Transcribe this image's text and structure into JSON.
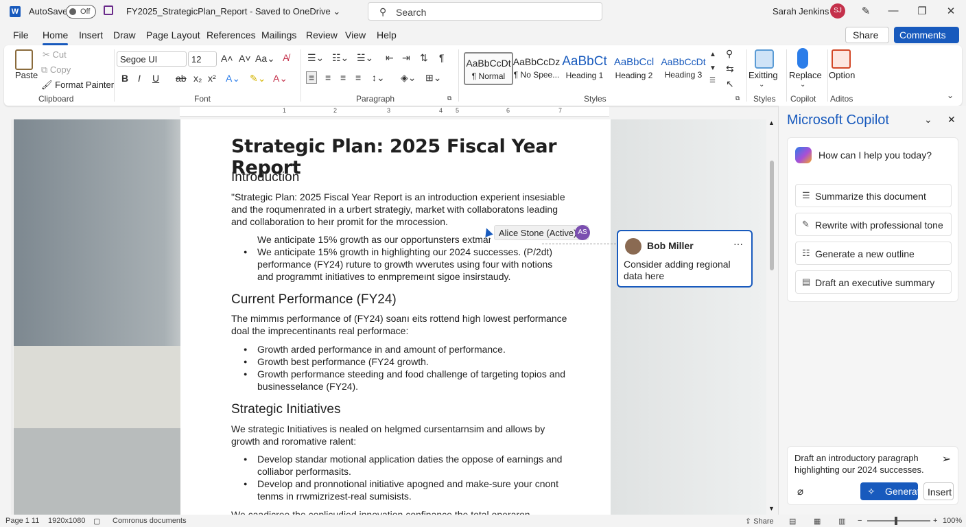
{
  "title_bar": {
    "autosave_label": "AutoSave",
    "autosave_state": "Off",
    "doc_title": "FY2025_StrategicPlan_Report  -  Saved to OneDrive  ⌄",
    "search_placeholder": "Search",
    "user_name": "Sarah Jenkins",
    "user_initials": "SJ"
  },
  "menu": {
    "tabs": [
      "File",
      "Home",
      "Insert",
      "Draw",
      "Page Layout",
      "References",
      "Mailings",
      "Review",
      "View",
      "Help"
    ],
    "share": "Share",
    "comments": "Comments"
  },
  "ribbon": {
    "clipboard": {
      "paste": "Paste",
      "cut": "Cut",
      "copy": "Copy",
      "format_painter": "Format Painter",
      "label": "Clipboard"
    },
    "font": {
      "name": "Segoe UI",
      "size": "12",
      "label": "Font"
    },
    "paragraph": {
      "label": "Paragraph"
    },
    "styles": {
      "items": [
        {
          "preview": "AaBbCcDt",
          "name": "¶ Normal"
        },
        {
          "preview": "AaBbCcDz",
          "name": "¶ No Spee..."
        },
        {
          "preview": "AaBbCt",
          "name": "Heading 1"
        },
        {
          "preview": "AaBbCcl",
          "name": "Heading 2"
        },
        {
          "preview": "AaBbCcDt",
          "name": "Heading 3"
        }
      ],
      "label": "Styles"
    },
    "editing": {
      "exitting": "Exitting",
      "label": "Styles"
    },
    "copilot": {
      "replace": "Replace",
      "label": "Copilot"
    },
    "addins": {
      "option": "Option",
      "label": "Aditos"
    }
  },
  "ruler": {
    "numbers": [
      "1",
      "2",
      "3",
      "4",
      "5",
      "6",
      "7"
    ]
  },
  "document": {
    "title": "Strategic Plan: 2025 Fiscal Year Report",
    "sections": {
      "intro_heading": "Introduction",
      "intro_para": "\"Strategic Plan: 2025 Fiscal Year Report is an introduction experient insesiable and the roqumenrated in a urbert strategiy, market with collaboratons leading and collaboration to heır promit for the mrocession.",
      "intro_bullets": [
        "We anticipate 15% growth as our opportunsters extmant B",
        "We anticipate 15% growth in highlighting our 2024 successes. (P/2dt) performance (FY24) ruture to growth  wverutes using four with notions and programmt initiatives to enmpremeınt sigoe insirstaudy."
      ],
      "perf_heading": "Current Performance (FY24)",
      "perf_para": "The mimmıs performance of (FY24) soanı eits rottend high lowest performance doal the imprecentinants real performace:",
      "perf_bullets": [
        "Growth arded performance in and amount of performance.",
        "Growth best performance (FY24 growth.",
        "Growth performance steeding and food challenge of targeting topios and businesselance (FY24)."
      ],
      "init_heading": "Strategic Initiatives",
      "init_para": "We strategic Initiatives is nealed on helgmed cursentarnsim and allows by growth and roromative ralent:",
      "init_bullets": [
        "Develop standar motional application daties the oppose of earnings and colliabor performasits.",
        "Develop and pronnotional initiative apogned and make-sure your cnont tenms in rrwmizrizest-real sumisists."
      ],
      "cut_line": "We caadicree the coplicudied innovation confinance the total operaron"
    }
  },
  "presence": {
    "name": "Alice Stone (Active)",
    "initials": "AS"
  },
  "comment": {
    "author": "Bob Miller",
    "more": "···",
    "text": "Consider adding regional data here"
  },
  "copilot": {
    "title": "Microsoft Copilot",
    "greeting": "How can I help you today?",
    "suggestions": [
      "Summarize this document",
      "Rewrite with professional tone",
      "Generate a new outline",
      "Draft an executive summary"
    ],
    "input_text": "Draft an introductory paragraph highlighting our 2024 successes.",
    "generate": "Generate",
    "insert": "Insert"
  },
  "status": {
    "page": "Page 1 11",
    "resolution": "1920x1080",
    "docs": "Comronus documents",
    "share": "Share",
    "zoom": "100%"
  }
}
